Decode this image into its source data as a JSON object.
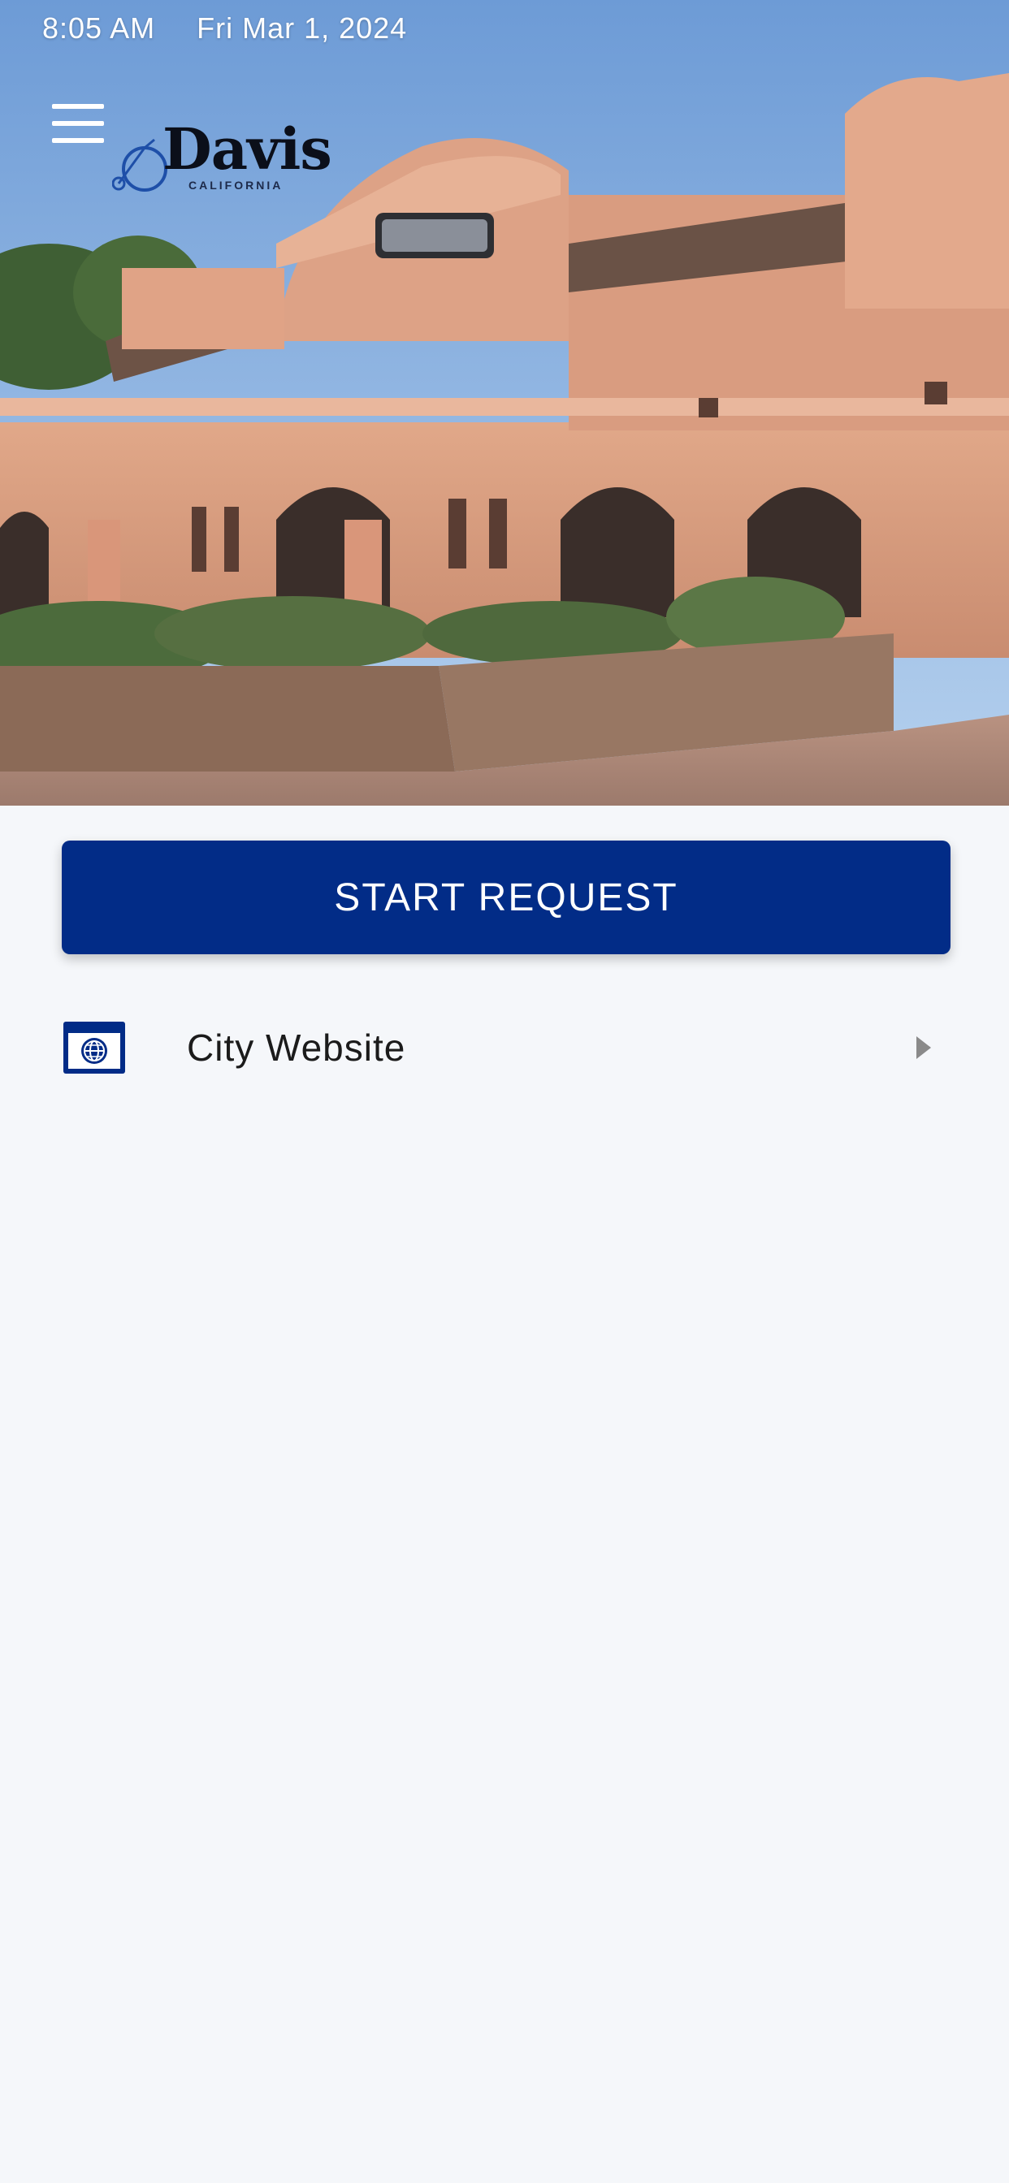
{
  "status_bar": {
    "time": "8:05 AM",
    "date": "Fri Mar 1, 2024"
  },
  "header": {
    "menu_icon": "hamburger-menu-icon",
    "logo": {
      "title": "Davis",
      "subtitle": "CALIFORNIA"
    },
    "hero_image": "davis-train-depot-photo"
  },
  "main": {
    "start_request_label": "START REQUEST",
    "links": [
      {
        "label": "City Website",
        "icon": "globe-browser-icon",
        "chevron": "caret-right-icon"
      }
    ]
  },
  "colors": {
    "primary": "#022c87",
    "background": "#f5f7fa",
    "chevron": "#8a8a8a"
  }
}
